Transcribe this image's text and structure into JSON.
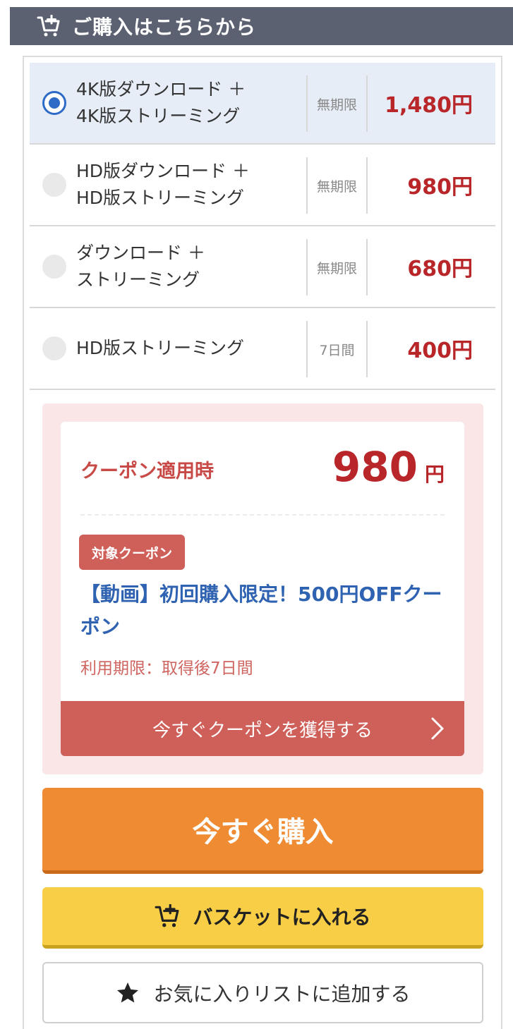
{
  "header": {
    "title": "ご購入はこちらから",
    "icon": "cart-plus-icon"
  },
  "options": [
    {
      "line1": "4K版ダウンロード ＋",
      "line2": "4K版ストリーミング",
      "period": "無期限",
      "price": "1,480円",
      "selected": true
    },
    {
      "line1": "HD版ダウンロード ＋",
      "line2": "HD版ストリーミング",
      "period": "無期限",
      "price": "980円",
      "selected": false
    },
    {
      "line1": "ダウンロード ＋",
      "line2": "ストリーミング",
      "period": "無期限",
      "price": "680円",
      "selected": false
    },
    {
      "line1": "HD版ストリーミング",
      "line2": "",
      "period": "7日間",
      "price": "400円",
      "selected": false
    }
  ],
  "coupon": {
    "applied_label": "クーポン適用時",
    "price_value": "980",
    "price_unit": "円",
    "badge": "対象クーポン",
    "name": "【動画】初回購入限定！500円OFFクーポン",
    "expiry": "利用期限：取得後7日間",
    "get_button": "今すぐクーポンを獲得する"
  },
  "actions": {
    "buy_now": "今すぐ購入",
    "basket": "バスケットに入れる",
    "favorite": "お気に入りリストに追加する"
  },
  "colors": {
    "header_bg": "#5b6170",
    "price_red": "#b8262a",
    "buy_orange": "#ef8c33",
    "basket_yellow": "#f7ce45",
    "coupon_red": "#cf5f59",
    "link_blue": "#2f63b2"
  }
}
